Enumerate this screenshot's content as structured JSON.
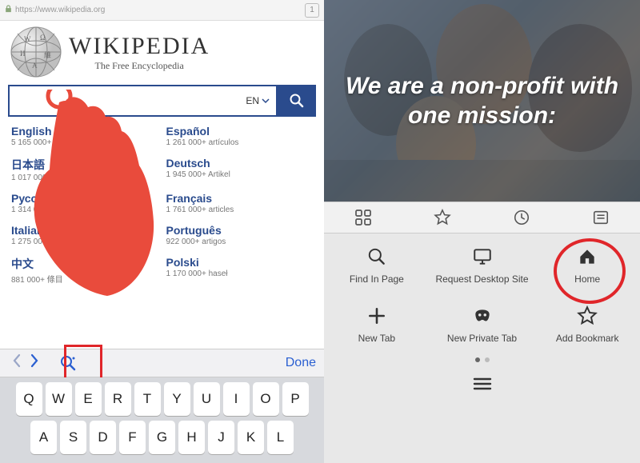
{
  "left": {
    "address_bar": {
      "url": "https://www.wikipedia.org",
      "tab_count": "1"
    },
    "header": {
      "title": "WIKIPEDIA",
      "subtitle": "The Free Encyclopedia"
    },
    "search": {
      "language_code": "EN"
    },
    "languages": [
      {
        "name": "English",
        "count": "5 165 000+ articles"
      },
      {
        "name": "Español",
        "count": "1 261 000+ artículos"
      },
      {
        "name": "日本語",
        "count": "1 017 000+"
      },
      {
        "name": "Deutsch",
        "count": "1 945 000+ Artikel"
      },
      {
        "name": "Русский",
        "count": "1 314 000+ статей"
      },
      {
        "name": "Français",
        "count": "1 761 000+ articles"
      },
      {
        "name": "Italiano",
        "count": "1 275 000+ voci"
      },
      {
        "name": "Português",
        "count": "922 000+ artigos"
      },
      {
        "name": "中文",
        "count": "881 000+ 條目"
      },
      {
        "name": "Polski",
        "count": "1 170 000+ haseł"
      }
    ],
    "keyboard_accessory": {
      "done": "Done"
    },
    "keyboard": {
      "row1": [
        "Q",
        "W",
        "E",
        "R",
        "T",
        "Y",
        "U",
        "I",
        "O",
        "P"
      ],
      "row2": [
        "A",
        "S",
        "D",
        "F",
        "G",
        "H",
        "J",
        "K",
        "L"
      ]
    }
  },
  "right": {
    "hero_text": "We are a non-profit with one mission:",
    "menu": {
      "row1": [
        {
          "id": "find-in-page",
          "label": "Find In Page"
        },
        {
          "id": "request-desktop",
          "label": "Request Desktop Site"
        },
        {
          "id": "home",
          "label": "Home"
        }
      ],
      "row2": [
        {
          "id": "new-tab",
          "label": "New Tab"
        },
        {
          "id": "new-private-tab",
          "label": "New Private Tab"
        },
        {
          "id": "add-bookmark",
          "label": "Add Bookmark"
        }
      ]
    }
  }
}
